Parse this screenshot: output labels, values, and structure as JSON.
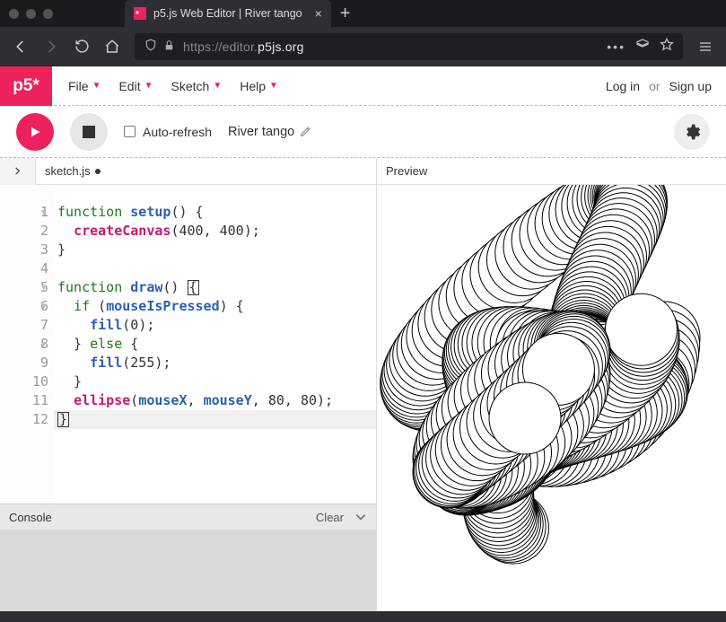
{
  "browser": {
    "tab_title": "p5.js Web Editor | River tango",
    "url_muted_pre": "https://editor.",
    "url_bold": "p5js.org",
    "url_muted_post": ""
  },
  "logo": "p5*",
  "menus": [
    "File",
    "Edit",
    "Sketch",
    "Help"
  ],
  "auth": {
    "login": "Log in",
    "or": "or",
    "signup": "Sign up"
  },
  "controls": {
    "auto_refresh_label": "Auto-refresh",
    "sketch_name": "River tango"
  },
  "file": {
    "name": "sketch.js",
    "unsaved": true
  },
  "code": {
    "lines": [
      {
        "n": 1,
        "fold": true,
        "html": "<span class='kw'>function</span> <span class='fn'>setup</span>() {"
      },
      {
        "n": 2,
        "html": "  <span class='hl'>createCanvas</span>(<span class='num'>400</span>, <span class='num'>400</span>);"
      },
      {
        "n": 3,
        "html": "}"
      },
      {
        "n": 4,
        "html": ""
      },
      {
        "n": 5,
        "fold": true,
        "html": "<span class='kw'>function</span> <span class='fn'>draw</span>() <span class='cursor-box'>{</span>"
      },
      {
        "n": 6,
        "fold": true,
        "html": "  <span class='kw'>if</span> (<span class='fn'>mouseIsPressed</span>) {"
      },
      {
        "n": 7,
        "html": "    <span class='fn'>fill</span>(<span class='num'>0</span>);"
      },
      {
        "n": 8,
        "fold": true,
        "html": "  } <span class='kw'>else</span> {"
      },
      {
        "n": 9,
        "html": "    <span class='fn'>fill</span>(<span class='num'>255</span>);"
      },
      {
        "n": 10,
        "html": "  }"
      },
      {
        "n": 11,
        "html": "  <span class='hl'>ellipse</span>(<span class='fn'>mouseX</span>, <span class='fn'>mouseY</span>, <span class='num'>80</span>, <span class='num'>80</span>);"
      },
      {
        "n": 12,
        "hl": true,
        "html": "<span class='cursor-box'>}</span>"
      }
    ]
  },
  "console": {
    "label": "Console",
    "clear": "Clear"
  },
  "preview": {
    "label": "Preview"
  },
  "chart_data": null
}
